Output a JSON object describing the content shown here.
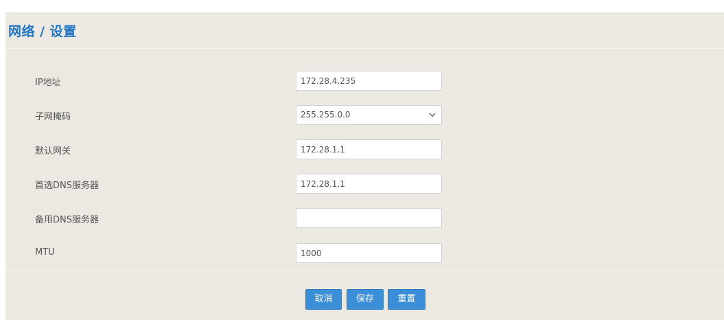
{
  "header": {
    "title": "网络 / 设置"
  },
  "form": {
    "fields": [
      {
        "label": "IP地址",
        "value": "172.28.4.235",
        "type": "text"
      },
      {
        "label": "子网掩码",
        "value": "255.255.0.0",
        "type": "select"
      },
      {
        "label": "默认网关",
        "value": "172.28.1.1",
        "type": "text"
      },
      {
        "label": "首选DNS服务器",
        "value": "172.28.1.1",
        "type": "text"
      },
      {
        "label": "备用DNS服务器",
        "value": "",
        "type": "text"
      },
      {
        "label": "MTU",
        "value": "1000",
        "type": "text"
      }
    ]
  },
  "buttons": {
    "cancel_label": "取消",
    "save_label": "保存",
    "reset_label": "重置"
  },
  "colors": {
    "title": "#1f76c4",
    "panel_background": "#ebe9e2",
    "button": "#3b8fd8"
  },
  "icons": {
    "select_arrow": "chevron-down-icon"
  }
}
